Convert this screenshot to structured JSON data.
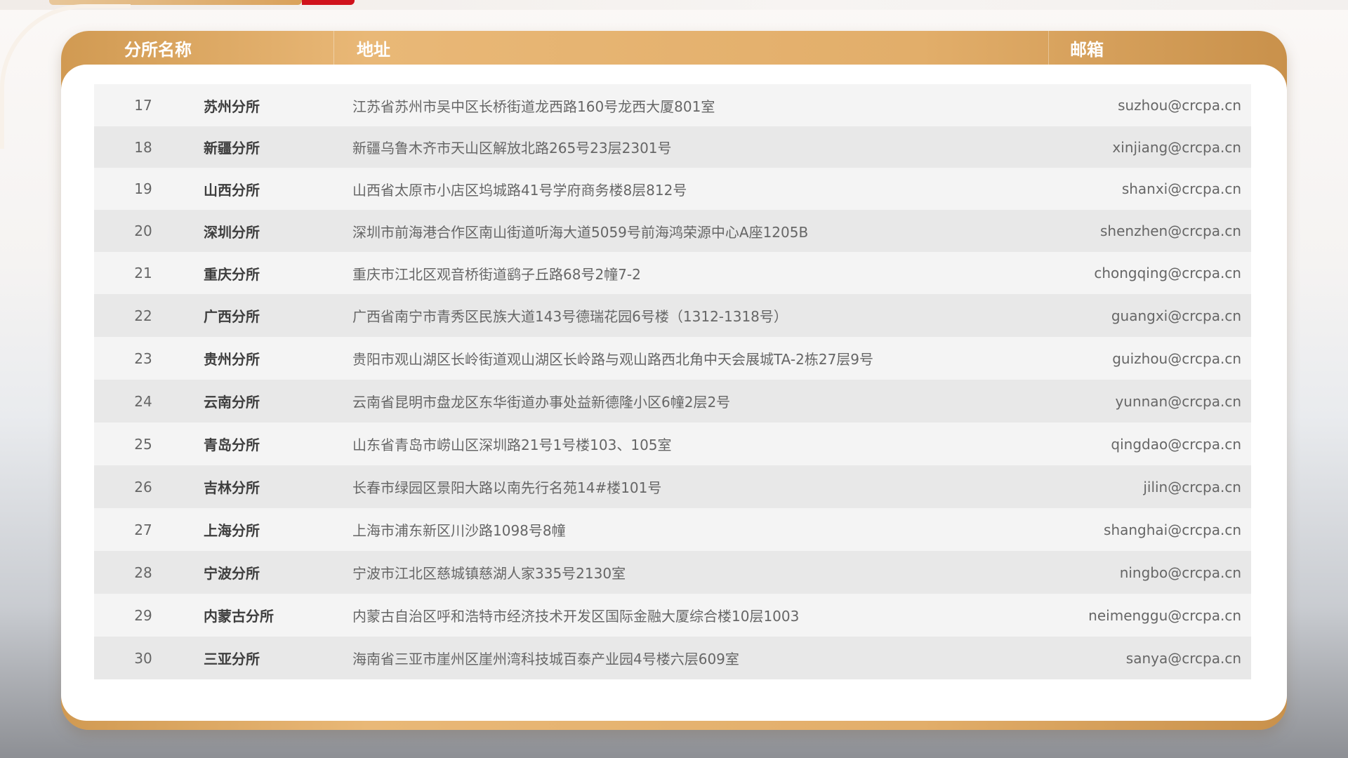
{
  "table": {
    "headers": {
      "name": "分所名称",
      "address": "地址",
      "email": "邮箱"
    },
    "rows": [
      {
        "num": "17",
        "name": "苏州分所",
        "address": "江苏省苏州市吴中区长桥街道龙西路160号龙西大厦801室",
        "email": "suzhou@crcpa.cn"
      },
      {
        "num": "18",
        "name": "新疆分所",
        "address": "新疆乌鲁木齐市天山区解放北路265号23层2301号",
        "email": "xinjiang@crcpa.cn"
      },
      {
        "num": "19",
        "name": "山西分所",
        "address": "山西省太原市小店区坞城路41号学府商务楼8层812号",
        "email": "shanxi@crcpa.cn"
      },
      {
        "num": "20",
        "name": "深圳分所",
        "address": "深圳市前海港合作区南山街道听海大道5059号前海鸿荣源中心A座1205B",
        "email": "shenzhen@crcpa.cn"
      },
      {
        "num": "21",
        "name": "重庆分所",
        "address": "重庆市江北区观音桥街道鹞子丘路68号2幢7-2",
        "email": "chongqing@crcpa.cn"
      },
      {
        "num": "22",
        "name": "广西分所",
        "address": "广西省南宁市青秀区民族大道143号德瑞花园6号楼（1312-1318号）",
        "email": "guangxi@crcpa.cn"
      },
      {
        "num": "23",
        "name": "贵州分所",
        "address": "贵阳市观山湖区长岭街道观山湖区长岭路与观山路西北角中天会展城TA-2栋27层9号",
        "email": "guizhou@crcpa.cn"
      },
      {
        "num": "24",
        "name": "云南分所",
        "address": "云南省昆明市盘龙区东华街道办事处益新德隆小区6幢2层2号",
        "email": "yunnan@crcpa.cn"
      },
      {
        "num": "25",
        "name": "青岛分所",
        "address": "山东省青岛市崂山区深圳路21号1号楼103、105室",
        "email": "qingdao@crcpa.cn"
      },
      {
        "num": "26",
        "name": "吉林分所",
        "address": "长春市绿园区景阳大路以南先行名苑14#楼101号",
        "email": "jilin@crcpa.cn"
      },
      {
        "num": "27",
        "name": "上海分所",
        "address": "上海市浦东新区川沙路1098号8幢",
        "email": "shanghai@crcpa.cn"
      },
      {
        "num": "28",
        "name": "宁波分所",
        "address": "宁波市江北区慈城镇慈湖人家335号2130室",
        "email": "ningbo@crcpa.cn"
      },
      {
        "num": "29",
        "name": "内蒙古分所",
        "address": "内蒙古自治区呼和浩特市经济技术开发区国际金融大厦综合楼10层1003",
        "email": "neimenggu@crcpa.cn"
      },
      {
        "num": "30",
        "name": "三亚分所",
        "address": "海南省三亚市崖州区崖州湾科技城百泰产业园4号楼六层609室",
        "email": "sanya@crcpa.cn"
      }
    ]
  },
  "colors": {
    "header_gold": "#e2ae6a",
    "accent_red": "#d0121b",
    "row_odd": "#f4f4f4",
    "row_even": "#e8e8e8"
  }
}
